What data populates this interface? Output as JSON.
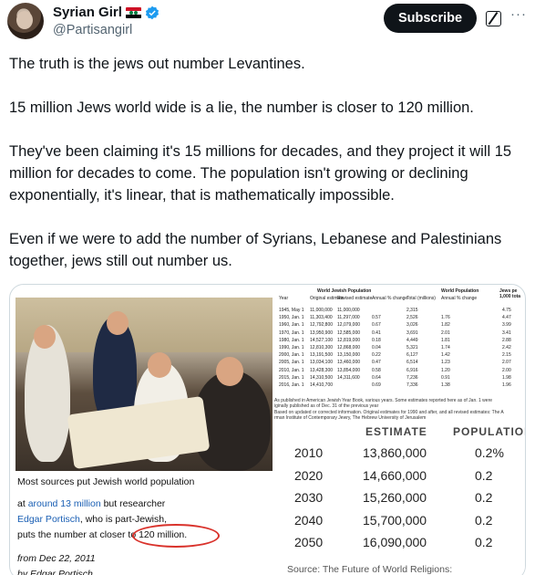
{
  "author": {
    "name": "Syrian Girl",
    "handle": "@Partisangirl",
    "flag_icon": "syria-flag-icon",
    "verified_icon": "verified-badge-icon"
  },
  "actions": {
    "subscribe_label": "Subscribe",
    "grok_icon": "grok-icon",
    "more_icon": "more-icon",
    "more_glyph": "···"
  },
  "colors": {
    "verified": "#1d9bf0",
    "subscribe_bg": "#0f1419",
    "link": "#1a5fb4",
    "ring": "#d9322b"
  },
  "tweet": {
    "p1": "The truth is the jews out number Levantines.",
    "p2": "15 million Jews world wide is a lie, the number is closer to 120 million.",
    "p3": "They've been claiming it's 15 millions for decades, and they project it will 15 million for decades to come. The population isn't growing or declining exponentially, it's linear, that is mathematically impossible.",
    "p4": "Even if we were to add the number of  Syrians, Lebanese and Palestinians together, jews still out number us."
  },
  "media": {
    "caption": {
      "line1": "Most sources put Jewish world population",
      "line2_pre": "at ",
      "line2_link": "around 13 million",
      "line2_post": " but researcher",
      "line3_link": "Edgar Portisch",
      "line3_post": ", who is  part-Jewish,",
      "line4_pre": "puts the number at closer to ",
      "line4_em": "120 million.",
      "line5": "from Dec 22, 2011",
      "line6": "by Edgar Portisch"
    },
    "table": {
      "group_jewish": "World Jewish Population",
      "group_world": "World Population",
      "col_jews": "Jews pe 1,000 tota",
      "headers": [
        "Year",
        "Original estimate",
        "Revised estimate",
        "Annual % change",
        "Total (millions)",
        "Annual % change"
      ],
      "rows": [
        [
          "1945, May 1",
          "11,000,000",
          "11,000,000",
          "",
          "2,315",
          "",
          "4.75"
        ],
        [
          "1950, Jan. 1",
          "11,303,400",
          "11,297,000",
          "0.57",
          "2,526",
          "1.76",
          "4.47"
        ],
        [
          "1960, Jan. 1",
          "12,792,800",
          "12,079,000",
          "0.67",
          "3,026",
          "1.82",
          "3.99"
        ],
        [
          "1970, Jan. 1",
          "13,950,900",
          "12,585,000",
          "0.41",
          "3,691",
          "2.01",
          "3.41"
        ],
        [
          "1980, Jan. 1",
          "14,527,100",
          "12,819,000",
          "0.18",
          "4,449",
          "1.81",
          "2.88"
        ],
        [
          "1990, Jan. 1",
          "12,810,300",
          "12,868,000",
          "0.04",
          "5,321",
          "1.74",
          "2.42"
        ],
        [
          "2000, Jan. 1",
          "13,191,500",
          "13,150,000",
          "0.22",
          "6,127",
          "1.42",
          "2.15"
        ],
        [
          "2005, Jan. 1",
          "13,034,100",
          "13,460,000",
          "0.47",
          "6,514",
          "1.23",
          "2.07"
        ],
        [
          "2010, Jan. 1",
          "13,428,300",
          "13,854,000",
          "0.58",
          "6,916",
          "1.20",
          "2.00"
        ],
        [
          "2015, Jan. 1",
          "14,310,500",
          "14,311,600",
          "0.64",
          "7,236",
          "0.91",
          "1.98"
        ],
        [
          "2016, Jan. 1",
          "14,410,700",
          "",
          "0.69",
          "7,336",
          "1.38",
          "1.96"
        ]
      ],
      "notes": [
        "As published in American Jewish Year Book, various years. Some estimates reported here as of Jan. 1 were",
        "iginally published as of Dec. 31 of the previous year",
        "Based on updated or corrected information. Original estimates for 1990 and after, and all revised estimates: The A",
        "rman Institute of Contemporary Jewry, The Hebrew University of Jerusalem",
        "Based on revised estimates, except latest year",
        "Mid-year estimates. Source: United Nations (2015) and Population Reference Bureau (2015)"
      ]
    },
    "projection": {
      "col_estimate": "ESTIMATE",
      "col_growth": "POPULATION",
      "rows": [
        [
          "2010",
          "13,860,000",
          "0.2%"
        ],
        [
          "2020",
          "14,660,000",
          "0.2"
        ],
        [
          "2030",
          "15,260,000",
          "0.2"
        ],
        [
          "2040",
          "15,700,000",
          "0.2"
        ],
        [
          "2050",
          "16,090,000",
          "0.2"
        ]
      ],
      "source": "Source: The Future of World Religions:"
    }
  }
}
